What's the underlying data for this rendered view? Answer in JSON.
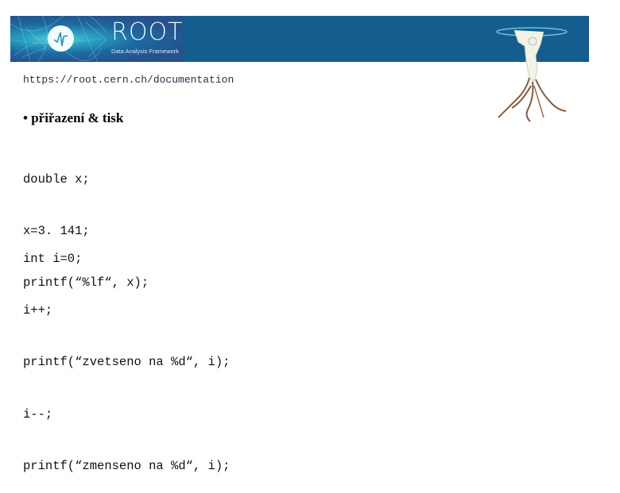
{
  "banner": {
    "logo_title": "ROOT",
    "logo_subtitle": "Data Analysis Framework",
    "colors": {
      "banner_bg": "#135e8e",
      "logo_panel": "#25528e",
      "logo_glow": "#5fd4e4"
    },
    "icons": {
      "logo": "root-sqrt-logo-icon",
      "mascot": "root-mascot-figure-icon"
    }
  },
  "content": {
    "url": "https://root.cern.ch/documentation",
    "bullet": "•",
    "heading": "přiřazení & tisk",
    "code_block_1": [
      "double x;",
      "x=3. 141;",
      "printf(“%lf“, x);"
    ],
    "code_block_2": [
      "int i=0;",
      "i++;",
      "printf(“zvetseno na %d“, i);",
      "i--;",
      "printf(“zmenseno na %d“, i);"
    ]
  }
}
